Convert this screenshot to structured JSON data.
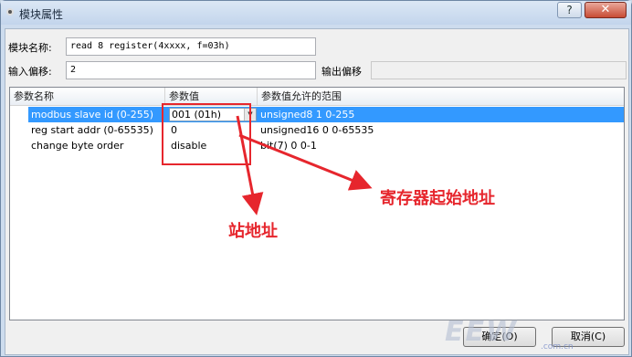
{
  "window": {
    "title": "模块属性",
    "help_label": "?",
    "close_label": "✕"
  },
  "form": {
    "module_name_label": "模块名称:",
    "module_name_value": "read 8 register(4xxxx, f=03h)",
    "input_offset_label": "输入偏移:",
    "input_offset_value": "2",
    "output_offset_label": "输出偏移",
    "output_offset_value": ""
  },
  "grid": {
    "headers": [
      "参数名称",
      "参数值",
      "参数值允许的范围"
    ],
    "rows": [
      {
        "name": "modbus slave id (0-255)",
        "value": "001 (01h)",
        "range": "unsigned8 1 0-255"
      },
      {
        "name": "reg start addr (0-65535)",
        "value": "0",
        "range": "unsigned16 0 0-65535"
      },
      {
        "name": "change byte order",
        "value": "disable",
        "range": "bit(7) 0 0-1"
      }
    ],
    "dropdown_arrow": "▼"
  },
  "annotations": {
    "register_start": "寄存器起始地址",
    "station_addr": "站地址",
    "color": "#e6262d"
  },
  "buttons": {
    "ok_label": "确定(O)",
    "cancel_label": "取消(C)"
  },
  "watermark": {
    "logo": "EEW",
    "site": ".com.cn"
  }
}
